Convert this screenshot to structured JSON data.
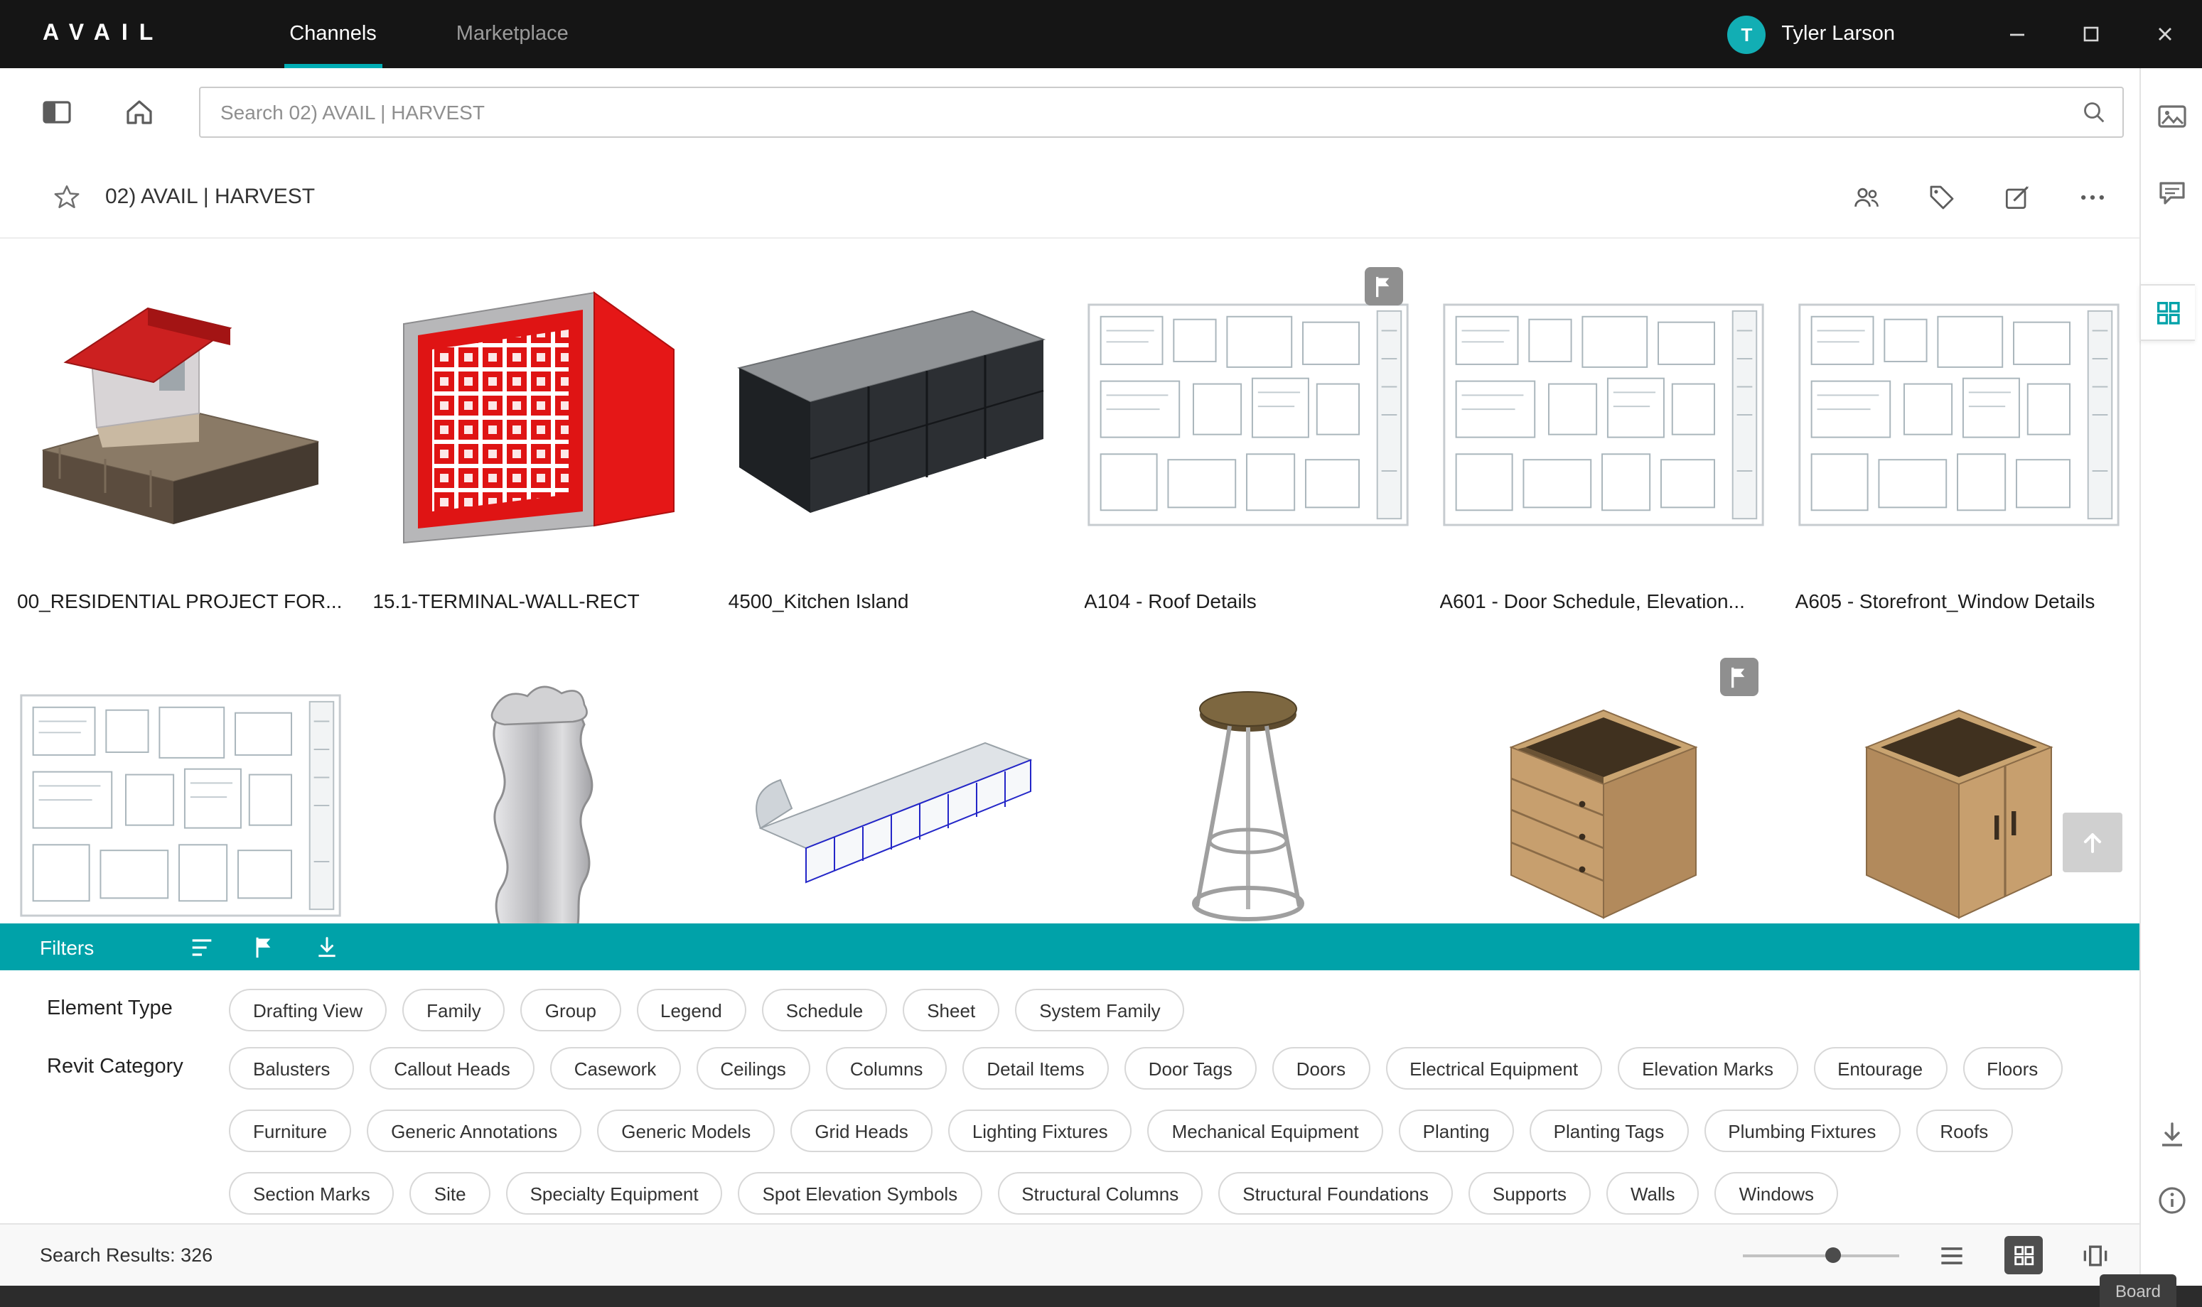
{
  "colors": {
    "accent_teal": "#00A2A9",
    "avatar_teal": "#12AEB4",
    "flag_badge_gray": "#8F8F8F",
    "terminal_wall_red": "#DF1414",
    "titlebar_dark": "#151515"
  },
  "titlebar": {
    "logo": "AVAIL",
    "tabs": [
      {
        "label": "Channels",
        "active": true
      },
      {
        "label": "Marketplace",
        "active": false
      }
    ],
    "user": {
      "initial": "T",
      "name": "Tyler Larson"
    }
  },
  "toolbar": {
    "search_placeholder": "Search 02) AVAIL | HARVEST"
  },
  "channel_header": {
    "title": "02) AVAIL | HARVEST"
  },
  "cards_row1": [
    {
      "title": "00_RESIDENTIAL PROJECT FOR...",
      "thumb": "residential-house-model",
      "flagged": false
    },
    {
      "title": "15.1-TERMINAL-WALL-RECT",
      "thumb": "red-terminal-wall-panel",
      "flagged": false
    },
    {
      "title": "4500_Kitchen Island",
      "thumb": "dark-kitchen-island",
      "flagged": false
    },
    {
      "title": "A104 - Roof Details",
      "thumb": "drawing-sheet",
      "flagged": true
    },
    {
      "title": "A601 - Door Schedule, Elevation...",
      "thumb": "drawing-sheet",
      "flagged": false
    },
    {
      "title": "A605 - Storefront_Window Details",
      "thumb": "drawing-sheet",
      "flagged": false
    }
  ],
  "cards_row2": [
    {
      "thumb": "drawing-sheet",
      "flagged": false
    },
    {
      "thumb": "wavy-metal-column",
      "flagged": false
    },
    {
      "thumb": "building-section-model",
      "flagged": false
    },
    {
      "thumb": "bar-stool",
      "flagged": false
    },
    {
      "thumb": "open-top-cabinet",
      "flagged": true
    },
    {
      "thumb": "double-door-cabinet",
      "flagged": false
    }
  ],
  "filters": {
    "bar_label": "Filters",
    "element_type": {
      "label": "Element Type",
      "options": [
        "Drafting View",
        "Family",
        "Group",
        "Legend",
        "Schedule",
        "Sheet",
        "System Family"
      ]
    },
    "revit_category": {
      "label": "Revit Category",
      "options": [
        "Balusters",
        "Callout Heads",
        "Casework",
        "Ceilings",
        "Columns",
        "Detail Items",
        "Door Tags",
        "Doors",
        "Electrical Equipment",
        "Elevation Marks",
        "Entourage",
        "Floors",
        "Furniture",
        "Generic Annotations",
        "Generic Models",
        "Grid Heads",
        "Lighting Fixtures",
        "Mechanical Equipment",
        "Planting",
        "Planting Tags",
        "Plumbing Fixtures",
        "Roofs",
        "Section Marks",
        "Site",
        "Specialty Equipment",
        "Spot Elevation Symbols",
        "Structural Columns",
        "Structural Foundations",
        "Supports",
        "Walls",
        "Windows"
      ]
    }
  },
  "statusbar": {
    "results_label": "Search Results: 326"
  },
  "bottom": {
    "board_label": "Board"
  }
}
